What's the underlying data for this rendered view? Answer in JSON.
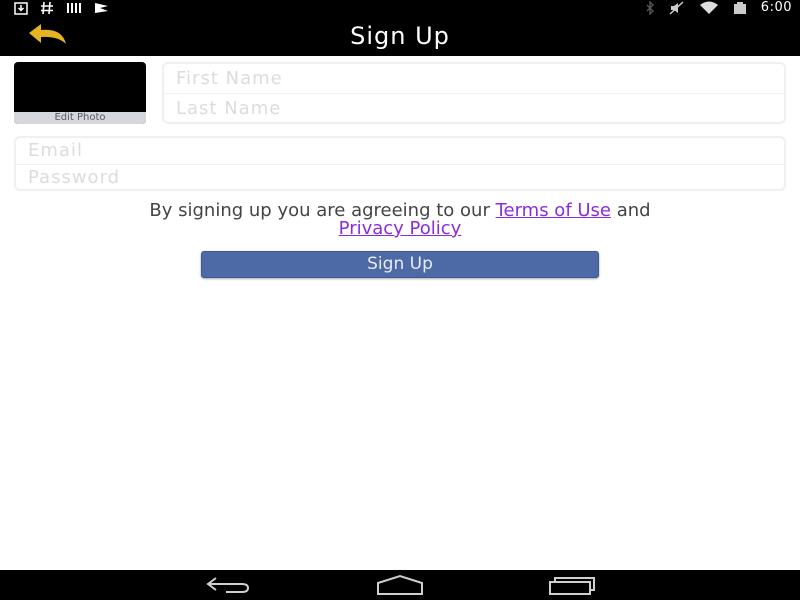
{
  "status_bar": {
    "left_icons": [
      "download-icon",
      "hash-icon",
      "signal-bars-icon",
      "flag-icon"
    ],
    "right_icons": [
      "bluetooth-icon",
      "mute-icon",
      "wifi-icon",
      "battery-icon"
    ],
    "time": "6:00"
  },
  "header": {
    "title": "Sign Up",
    "back_icon": "back-arrow-icon",
    "back_icon_color": "#e5b324"
  },
  "profile": {
    "photo_caption": "Edit Photo"
  },
  "form": {
    "first_name_placeholder": "First Name",
    "last_name_placeholder": "Last Name",
    "email_placeholder": "Email",
    "password_placeholder": "Password"
  },
  "terms": {
    "prefix": "By signing up you are agreeing to our ",
    "terms_link": "Terms of Use",
    "middle": " and",
    "privacy_link": "Privacy Policy",
    "link_color": "#8a2be2"
  },
  "signup_button": {
    "label": "Sign Up",
    "color": "#4e6aa6"
  },
  "nav_bar": {
    "icons": [
      "nav-back-icon",
      "nav-home-icon",
      "nav-recents-icon"
    ]
  }
}
